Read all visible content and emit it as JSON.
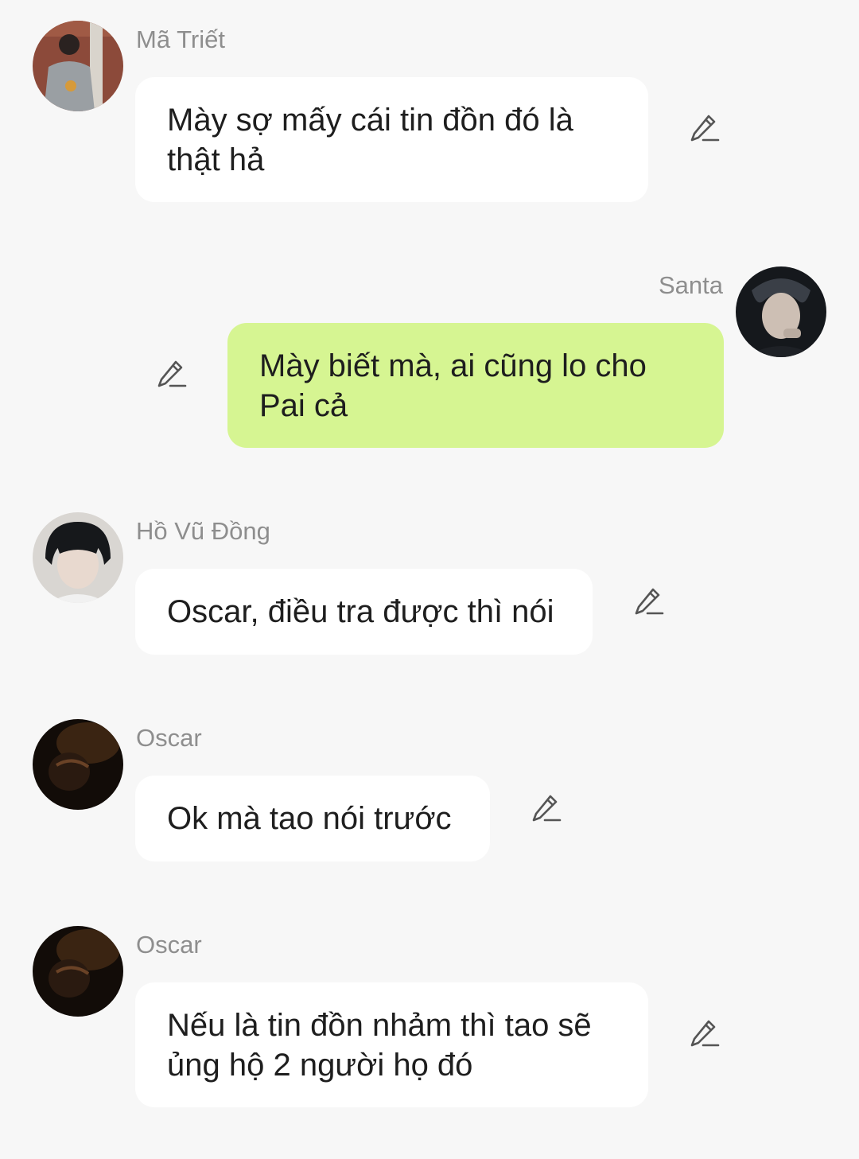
{
  "messages": [
    {
      "sender": "Mã Triết",
      "text": "Mày sợ mấy cái tin đồn đó là thật hả",
      "direction": "incoming",
      "avatar": "avatar-ma-triet"
    },
    {
      "sender": "Santa",
      "text": "Mày biết mà, ai cũng lo cho Pai cả",
      "direction": "outgoing",
      "avatar": "avatar-santa"
    },
    {
      "sender": "Hồ Vũ Đồng",
      "text": "Oscar, điều tra được thì nói",
      "direction": "incoming",
      "avatar": "avatar-ho-vu-dong"
    },
    {
      "sender": "Oscar",
      "text": "Ok mà tao nói trước",
      "direction": "incoming",
      "avatar": "avatar-oscar"
    },
    {
      "sender": "Oscar",
      "text": "Nếu là tin đồn nhảm thì tao sẽ ủng hộ 2 người họ đó",
      "direction": "incoming",
      "avatar": "avatar-oscar"
    }
  ],
  "icons": {
    "edit": "pencil-edit-icon"
  },
  "colors": {
    "background": "#f7f7f7",
    "incoming_bubble": "#ffffff",
    "outgoing_bubble": "#d6f592",
    "sender_name": "#8e8e8e",
    "message_text": "#1e1e1e",
    "icon": "#555555"
  }
}
